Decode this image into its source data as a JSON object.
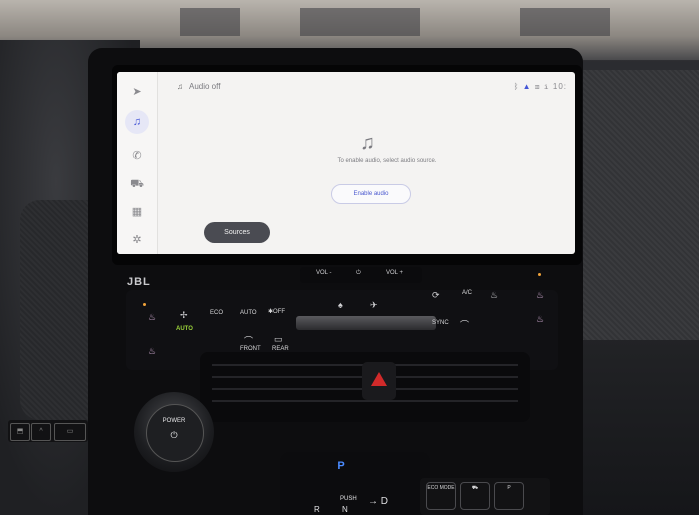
{
  "screen": {
    "rail_icons": [
      "navigation-icon",
      "music-icon",
      "phone-icon",
      "car-icon",
      "apps-icon",
      "settings-icon"
    ],
    "title": "Audio off",
    "status": {
      "clock": "10:"
    },
    "message": "To enable audio, select audio source.",
    "enable_button": "Enable audio",
    "sources_button": "Sources",
    "accent": "#4355d6"
  },
  "panel": {
    "brand": "JBL",
    "vol_down": "VOL -",
    "power_symbol": "⏻",
    "vol_up": "VOL +"
  },
  "climate": {
    "auto_green": "AUTO",
    "eco": "ECO",
    "auto": "AUTO",
    "off": "✱OFF",
    "front": "FRONT",
    "rear": "REAR",
    "ac": "A/C",
    "sync": "SYNC",
    "green": "#9bd33a"
  },
  "lower": {
    "power_label": "POWER",
    "shift_p": "P",
    "push": "PUSH",
    "shift_d": "→ D",
    "shift_r": "R",
    "shift_n": "N",
    "eco_mode": "ECO MODE",
    "hazard_color": "#d12a2a"
  }
}
